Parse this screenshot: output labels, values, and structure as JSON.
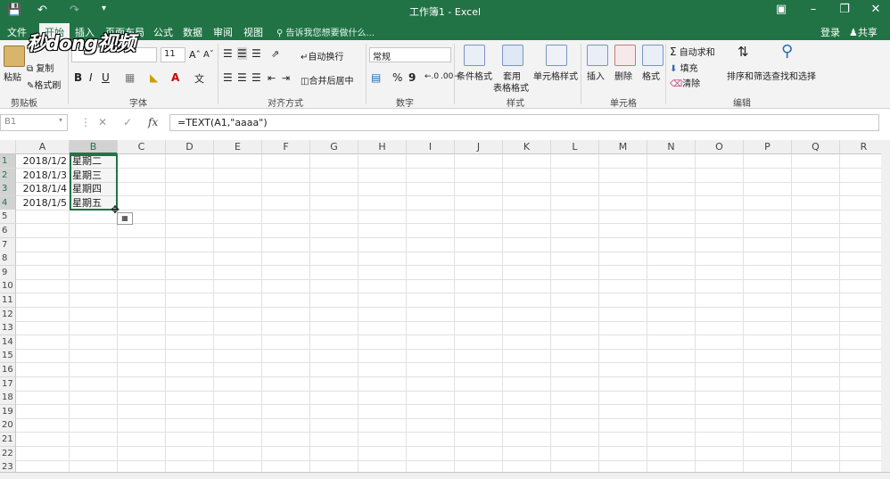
{
  "window": {
    "title": "工作簿1 - Excel"
  },
  "menu": {
    "tabs": [
      "文件",
      "开始",
      "插入",
      "页面布局",
      "公式",
      "数据",
      "审阅",
      "视图"
    ],
    "active": "开始",
    "tell_me": "告诉我您想要做什么...",
    "login": "登录",
    "share": "共享"
  },
  "ribbon": {
    "clipboard": {
      "paste": "粘贴",
      "copy": "复制",
      "format_painter": "格式刷",
      "label": "剪贴板"
    },
    "font": {
      "size": "11",
      "bold": "B",
      "italic": "I",
      "underline": "U",
      "label": "字体"
    },
    "alignment": {
      "wrap": "自动换行",
      "merge": "合并后居中",
      "label": "对齐方式"
    },
    "number": {
      "format": "常规",
      "percent": "%",
      "comma": "9",
      "label": "数字"
    },
    "styles": {
      "conditional": "条件格式",
      "table": "套用",
      "table2": "表格格式",
      "cell": "单元格样式",
      "label": "样式"
    },
    "cells": {
      "insert": "插入",
      "delete": "删除",
      "format": "格式",
      "label": "单元格"
    },
    "editing": {
      "autosum": "自动求和",
      "fill": "填充",
      "clear": "清除",
      "sort": "排序和筛选",
      "find": "查找和选择",
      "label": "编辑"
    }
  },
  "watermark": "秒dong视频",
  "formula_bar": {
    "name_box": "B1",
    "fx": "fx",
    "formula": "=TEXT(A1,\"aaaa\")"
  },
  "sheet": {
    "columns": [
      "A",
      "B",
      "C",
      "D",
      "E",
      "F",
      "G",
      "H",
      "I",
      "J",
      "K",
      "L",
      "M",
      "N",
      "O",
      "P",
      "Q",
      "R"
    ],
    "rows": [
      "1",
      "2",
      "3",
      "4",
      "5",
      "6",
      "7",
      "8",
      "9",
      "10",
      "11",
      "12",
      "13",
      "14",
      "15",
      "16",
      "17",
      "18",
      "19",
      "20",
      "21",
      "22",
      "23"
    ],
    "colA": [
      "2018/1/2",
      "2018/1/3",
      "2018/1/4",
      "2018/1/5"
    ],
    "colB": [
      "星期二",
      "星期三",
      "星期四",
      "星期五"
    ]
  }
}
